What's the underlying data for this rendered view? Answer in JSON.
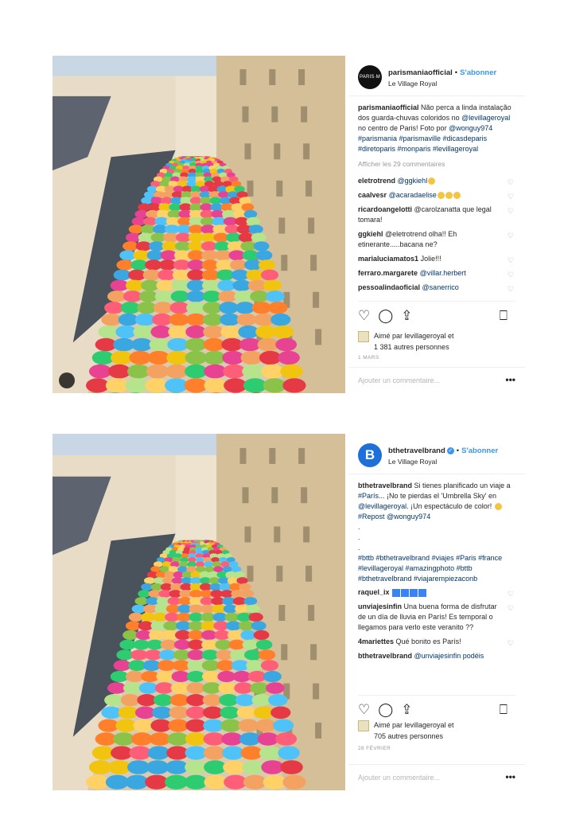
{
  "post1": {
    "username": "parismaniaofficial",
    "follow_label": "S'abonner",
    "location": "Le Village Royal",
    "avatar_text": "PARIS·M",
    "caption_user": "parismaniaofficial",
    "caption_text": "Não perca a linda instalação dos guarda-chuvas coloridos no ",
    "caption_mention": "@levillageroyal",
    "caption_text2": " no centro de Paris! Foto por ",
    "caption_tags": "@wonguy974 #parismania #parismaville #dicasdeparis #diretoparis #monparis #levillageroyal",
    "view_comments": "Afficher les 29 commentaires",
    "comments": [
      {
        "user": "eletrotrend",
        "text": "@ggkiehl"
      },
      {
        "user": "caalvesr",
        "text": "@acaradaelise"
      },
      {
        "user": "ricardoangelotti",
        "text": "@carolzanatta que legal tomara!"
      },
      {
        "user": "ggkiehl",
        "text": "@eletrotrend olha!! Eh etinerante.....bacana ne?"
      },
      {
        "user": "marialuciamatos1",
        "text": "Jolie!!!"
      },
      {
        "user": "ferraro.margarete",
        "text": "@villar.herbert"
      },
      {
        "user": "pessoalindaoficial",
        "text": "@sanerrico"
      }
    ],
    "liked_by": "Aimé par levillageroyal et",
    "liked_count": "1 381 autres personnes",
    "date": "1 MARS",
    "add_comment": "Ajouter un commentaire...",
    "more": "•••"
  },
  "post2": {
    "username": "bthetravelbrand",
    "follow_label": "S'abonner",
    "location": "Le Village Royal",
    "avatar_text": "B",
    "caption_user": "bthetravelbrand",
    "caption_text": "Si tienes planificado un viaje a ",
    "caption_mention": "#París",
    "caption_text2": "... ¡No te pierdas el 'Umbrella Sky' en ",
    "caption_mention2": "@levillageroyal",
    "caption_text3": ". ¡Un espectáculo de color! ",
    "caption_repost": "#Repost @wonguy974",
    "caption_dots": ".",
    "caption_tags": "#bttb #bthetravelbrand #viajes #Paris #france #levillageroyal #amazingphoto #bttb #bthetravelbrand #viajarempiezaconb",
    "comments": [
      {
        "user": "raquel_ix",
        "text": ""
      },
      {
        "user": "unviajesinfin",
        "text": "Una buena forma de disfrutar de un día de lluvia en París! Es temporal o llegamos para verlo este veranito ??"
      },
      {
        "user": "4mariettes",
        "text": "Qué bonito es París!"
      },
      {
        "user": "bthetravelbrand",
        "text": "@unviajesinfin podéis"
      }
    ],
    "liked_by": "Aimé par levillageroyal et",
    "liked_count": "705 autres personnes",
    "date": "28 FÉVRIER",
    "add_comment": "Ajouter un commentaire...",
    "more": "•••"
  },
  "icons": [
    "heart-icon",
    "comment-icon",
    "share-icon",
    "bookmark-icon",
    "verified-icon",
    "user-tag-icon"
  ],
  "colors": {
    "accent": "#3897f0",
    "link": "#003569",
    "muted": "#999999"
  }
}
